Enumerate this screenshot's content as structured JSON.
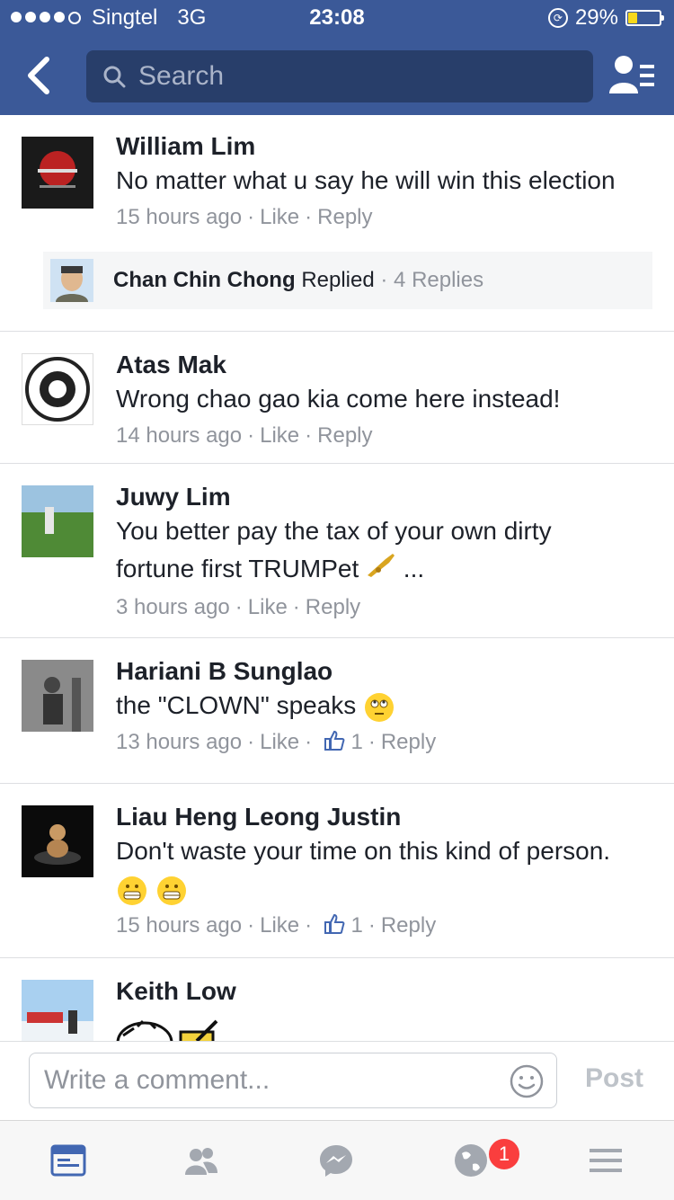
{
  "status_bar": {
    "carrier": "Singtel",
    "network": "3G",
    "time": "23:08",
    "battery": "29%"
  },
  "header": {
    "search_placeholder": "Search"
  },
  "comments": [
    {
      "name": "William Lim",
      "text": "No matter what u say he will win this election",
      "time": "15 hours ago",
      "like": "Like",
      "reply": "Reply",
      "replied": {
        "name": "Chan Chin Chong",
        "action": "Replied",
        "count": "4 Replies"
      }
    },
    {
      "name": "Atas Mak",
      "text": "Wrong chao gao kia come here instead!",
      "time": "14 hours ago",
      "like": "Like",
      "reply": "Reply"
    },
    {
      "name": "Juwy Lim",
      "text_line1": "You better pay the tax of your own dirty",
      "text_line2": "fortune first TRUMPet",
      "ellipsis": "...",
      "time": "3 hours ago",
      "like": "Like",
      "reply": "Reply"
    },
    {
      "name": "Hariani B Sunglao",
      "text": "the \"CLOWN\" speaks",
      "time": "13 hours ago",
      "like": "Like",
      "likes_count": "1",
      "reply": "Reply"
    },
    {
      "name": "Liau Heng Leong Justin",
      "text": "Don't waste your time on this kind of person.",
      "time": "15 hours ago",
      "like": "Like",
      "likes_count": "1",
      "reply": "Reply"
    },
    {
      "name": "Keith Low"
    }
  ],
  "composer": {
    "placeholder": "Write a comment...",
    "post_label": "Post"
  },
  "tabbar": {
    "notifications_badge": "1"
  },
  "colors": {
    "brand": "#3b5998",
    "accent": "#4267b2",
    "badge": "#fa3e3e"
  }
}
